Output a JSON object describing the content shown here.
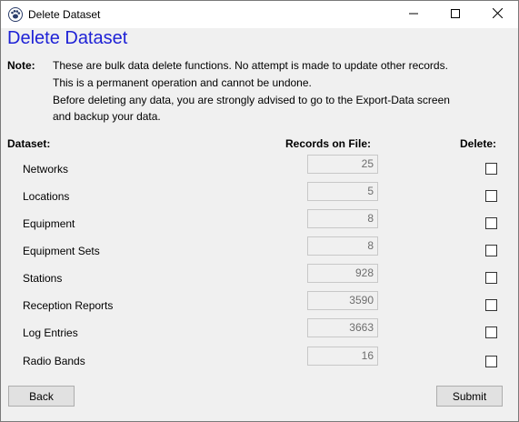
{
  "window": {
    "title": "Delete Dataset"
  },
  "heading": "Delete Dataset",
  "note": {
    "label": "Note:",
    "lines": [
      "These are bulk data delete functions. No attempt is made to update other records.",
      "This is a permanent operation and cannot be undone.",
      "Before deleting any data, you are strongly advised to go to the Export-Data screen",
      "and backup your data."
    ]
  },
  "columns": {
    "dataset": "Dataset:",
    "records": "Records on File:",
    "delete": "Delete:"
  },
  "rows": [
    {
      "label": "Networks",
      "count": "25",
      "checked": false
    },
    {
      "label": "Locations",
      "count": "5",
      "checked": false
    },
    {
      "label": "Equipment",
      "count": "8",
      "checked": false
    },
    {
      "label": "Equipment Sets",
      "count": "8",
      "checked": false
    },
    {
      "label": "Stations",
      "count": "928",
      "checked": false
    },
    {
      "label": "Reception Reports",
      "count": "3590",
      "checked": false
    },
    {
      "label": "Log Entries",
      "count": "3663",
      "checked": false
    },
    {
      "label": "Radio Bands",
      "count": "16",
      "checked": false
    }
  ],
  "buttons": {
    "back": "Back",
    "submit": "Submit"
  },
  "icons": {
    "app": "paw-print-icon",
    "minimize": "minimize-icon",
    "maximize": "maximize-icon",
    "close": "close-icon"
  },
  "colors": {
    "heading": "#1f22d6"
  }
}
